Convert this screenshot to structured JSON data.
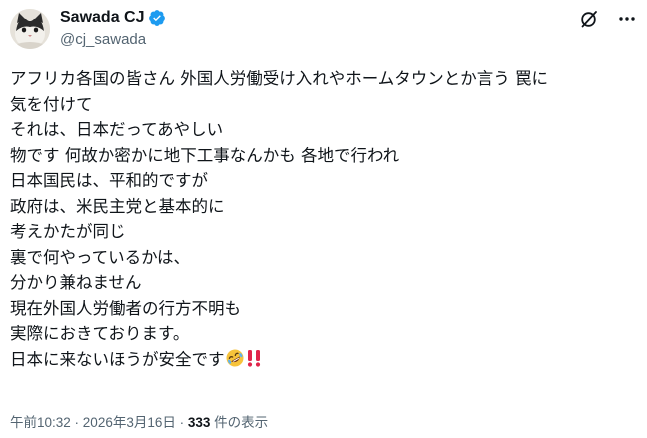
{
  "author": {
    "display_name": "Sawada CJ",
    "handle": "@cj_sawada",
    "verified": true,
    "verified_color": "#1d9bf0"
  },
  "header": {
    "grok_icon": "grok-slash-icon",
    "more_icon": "more-horizontal-icon"
  },
  "post": {
    "lines": [
      "アフリカ各国の皆さん 外国人労働受け入れやホームタウンとか言う 罠に",
      "気を付けて",
      "それは、日本だってあやしい",
      "物です 何故か密かに地下工事なんかも 各地で行われ",
      "日本国民は、平和的ですが",
      "政府は、米民主党と基本的に",
      "考えかたが同じ",
      "裏で何やっているかは、",
      "分かり兼ねません",
      "現在外国人労働者の行方不明も",
      "実際におきております。",
      "日本に来ないほうが安全です"
    ],
    "trailing_emoji": [
      "rolling-on-floor-laughing-emoji",
      "double-exclamation-emoji"
    ]
  },
  "meta": {
    "time": "午前10:32",
    "separator": " · ",
    "date": "2026年3月16日",
    "views_count": "333",
    "views_label": " 件の表示"
  }
}
